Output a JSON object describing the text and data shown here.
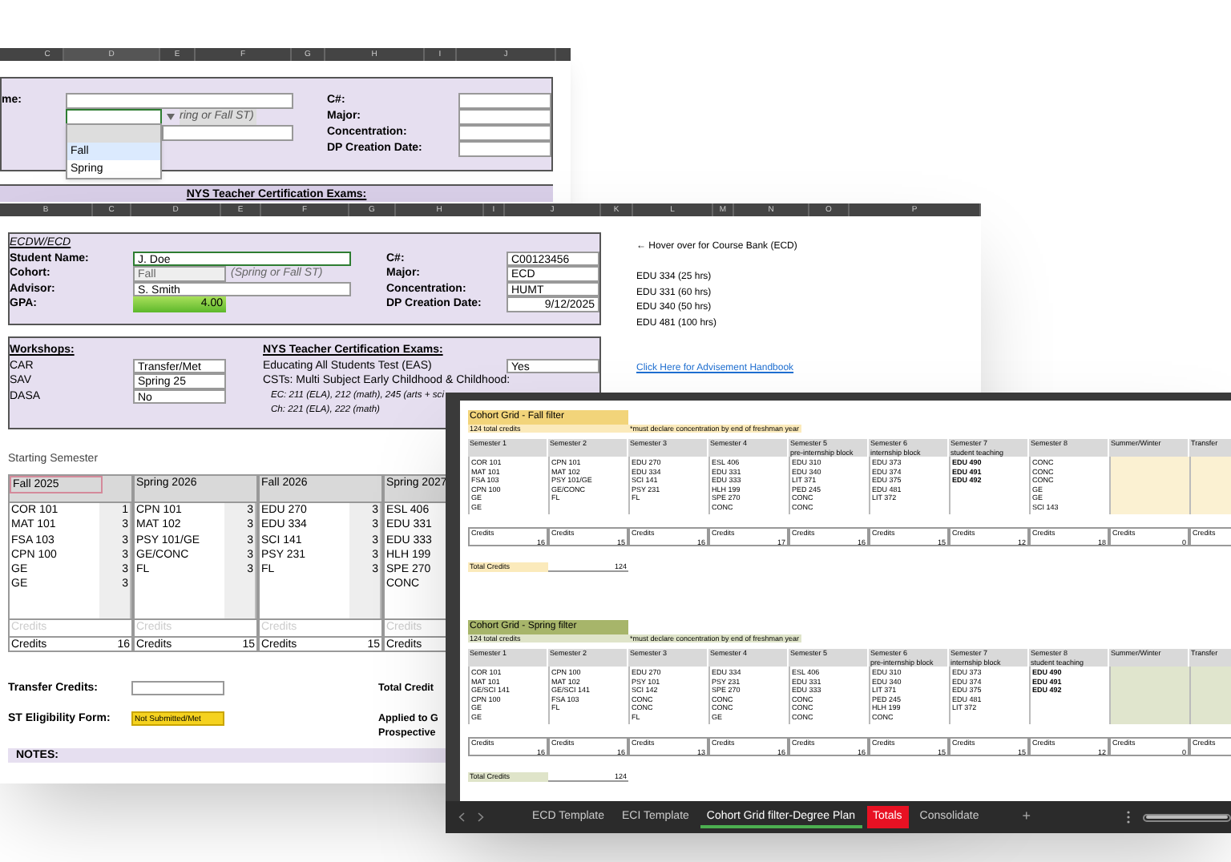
{
  "back_sheet": {
    "columns": [
      "C",
      "D",
      "E",
      "F",
      "G",
      "H",
      "I",
      "J"
    ],
    "student_label": "me:",
    "cohort_hint": "ring or Fall ST)",
    "dropdown_options": [
      {
        "label": "Fall",
        "selected": true
      },
      {
        "label": "Spring",
        "selected": false
      }
    ],
    "labels": [
      "C#:",
      "Major:",
      "Concentration:",
      "DP Creation Date:"
    ],
    "exams_heading": "NYS Teacher Certification Exams:"
  },
  "front_sheet": {
    "columns": [
      "B",
      "C",
      "D",
      "E",
      "F",
      "G",
      "H",
      "I",
      "J",
      "K",
      "L",
      "M",
      "N",
      "O",
      "P"
    ],
    "title": "ECDW/ECD",
    "student_fields": [
      {
        "label": "Student Name:",
        "value": "J. Doe"
      },
      {
        "label": "Cohort:",
        "value": "Fall",
        "hint": "(Spring or Fall ST)"
      },
      {
        "label": "Advisor:",
        "value": "S. Smith"
      },
      {
        "label": "GPA:",
        "value": "4.00"
      }
    ],
    "program_fields": [
      {
        "label": "C#:",
        "value": "C00123456"
      },
      {
        "label": "Major:",
        "value": "ECD"
      },
      {
        "label": "Concentration:",
        "value": "HUMT"
      },
      {
        "label": "DP Creation Date:",
        "value": "9/12/2025"
      }
    ],
    "workshops": {
      "heading": "Workshops:",
      "items": [
        {
          "label": "CAR",
          "value": "Transfer/Met"
        },
        {
          "label": "SAV",
          "value": "Spring 25"
        },
        {
          "label": "DASA",
          "value": "No"
        }
      ]
    },
    "exams": {
      "heading": "NYS Teacher Certification Exams:",
      "eas_label": "Educating All Students Test (EAS)",
      "eas_value": "Yes",
      "cst_label": "CSTs: Multi Subject Early Childhood & Childhood:",
      "cst_lines": [
        "EC: 211 (ELA), 212 (math), 245 (arts + sci",
        "Ch: 221 (ELA), 222 (math)"
      ]
    },
    "side_notes": {
      "hover_note": "← Hover over for Course Bank (ECD)",
      "hours": [
        "EDU 334 (25 hrs)",
        "EDU 331 (60 hrs)",
        "EDU 340 (50 hrs)",
        "EDU 481 (100 hrs)"
      ],
      "link": "Click Here for Advisement Handbook"
    },
    "starting_semester_label": "Starting Semester",
    "semesters": [
      {
        "name": "Fall 2025",
        "selected": true,
        "courses": [
          {
            "code": "COR 101",
            "credits": "1"
          },
          {
            "code": "MAT 101",
            "credits": "3"
          },
          {
            "code": "FSA 103",
            "credits": "3"
          },
          {
            "code": "CPN 100",
            "credits": "3"
          },
          {
            "code": "GE",
            "credits": "3"
          },
          {
            "code": "GE",
            "credits": "3"
          }
        ],
        "faded_label": "Credits",
        "credits_label": "Credits",
        "credits": "16"
      },
      {
        "name": "Spring 2026",
        "selected": false,
        "courses": [
          {
            "code": "CPN 101",
            "credits": "3"
          },
          {
            "code": "MAT 102",
            "credits": "3"
          },
          {
            "code": "PSY 101/GE",
            "credits": "3"
          },
          {
            "code": "GE/CONC",
            "credits": "3"
          },
          {
            "code": "FL",
            "credits": "3"
          }
        ],
        "faded_label": "Credits",
        "credits_label": "Credits",
        "credits": "15"
      },
      {
        "name": "Fall 2026",
        "selected": false,
        "courses": [
          {
            "code": "EDU 270",
            "credits": "3"
          },
          {
            "code": "EDU 334",
            "credits": "3"
          },
          {
            "code": "SCI 141",
            "credits": "3"
          },
          {
            "code": "PSY 231",
            "credits": "3"
          },
          {
            "code": "FL",
            "credits": "3"
          }
        ],
        "faded_label": "Credits",
        "credits_label": "Credits",
        "credits": "15"
      },
      {
        "name": "Spring 2027",
        "selected": false,
        "courses": [
          {
            "code": "ESL 406"
          },
          {
            "code": "EDU 331"
          },
          {
            "code": "EDU 333"
          },
          {
            "code": "HLH 199"
          },
          {
            "code": "SPE 270"
          },
          {
            "code": "CONC"
          }
        ],
        "faded_label": "Credits",
        "credits_label": "Credits"
      }
    ],
    "transfer_label": "Transfer Credits:",
    "st_label": "ST Eligibility Form:",
    "st_value": "Not Submitted/Met",
    "total_label": "Total Credit",
    "applied_lines": [
      "Applied to G",
      "Prospective"
    ],
    "notes_label": "NOTES:"
  },
  "cohort_sheet": {
    "grids": [
      {
        "kind": "fall",
        "title": "Cohort Grid - Fall filter",
        "subtitle": "124 total credits",
        "note": "*must declare concentration by end of freshman year",
        "total_label": "Total Credits",
        "total": "124",
        "columns": [
          {
            "header": "Semester 1",
            "bold": false,
            "tinted": false,
            "courses": [
              "COR 101",
              "MAT 101",
              "FSA 103",
              "CPN 100",
              "GE",
              "GE"
            ],
            "credits_label": "Credits",
            "credits": "16"
          },
          {
            "header": "Semester 2",
            "bold": false,
            "tinted": false,
            "courses": [
              "CPN 101",
              "MAT 102",
              "PSY 101/GE",
              "GE/CONC",
              "FL"
            ],
            "credits_label": "Credits",
            "credits": "15"
          },
          {
            "header": "Semester 3",
            "bold": false,
            "tinted": false,
            "courses": [
              "EDU 270",
              "EDU 334",
              "SCI 141",
              "PSY 231",
              "FL"
            ],
            "credits_label": "Credits",
            "credits": "16"
          },
          {
            "header": "Semester 4",
            "bold": false,
            "tinted": false,
            "courses": [
              "ESL 406",
              "EDU 331",
              "EDU 333",
              "HLH 199",
              "SPE 270",
              "CONC"
            ],
            "credits_label": "Credits",
            "credits": "17"
          },
          {
            "header": "Semester 5",
            "subheader": "pre-internship block",
            "bold": false,
            "tinted": false,
            "courses": [
              "EDU 310",
              "EDU 340",
              "LIT 371",
              "PED 245",
              "CONC",
              "CONC"
            ],
            "credits_label": "Credits",
            "credits": "16"
          },
          {
            "header": "Semester 6",
            "subheader": "internship block",
            "bold": false,
            "tinted": false,
            "courses": [
              "EDU 373",
              "EDU 374",
              "EDU 375",
              "EDU 481",
              "LIT 372"
            ],
            "credits_label": "Credits",
            "credits": "15"
          },
          {
            "header": "Semester 7",
            "subheader": "student teaching",
            "bold": true,
            "tinted": false,
            "courses": [
              "EDU 490",
              "EDU 491",
              "EDU 492"
            ],
            "credits_label": "Credits",
            "credits": "12"
          },
          {
            "header": "Semester 8",
            "bold": false,
            "tinted": false,
            "courses": [
              "CONC",
              "CONC",
              "CONC",
              "GE",
              "GE",
              "SCI 143"
            ],
            "credits_label": "Credits",
            "credits": "18"
          },
          {
            "header": "Summer/Winter",
            "tinted": true,
            "credits_label": "Credits",
            "credits": "0"
          },
          {
            "header": "Transfer",
            "tinted": true,
            "credits_label": "Credits"
          }
        ]
      },
      {
        "kind": "spring",
        "title": "Cohort Grid - Spring filter",
        "subtitle": "124 total credits",
        "note": "*must declare concentration by end of freshman year",
        "total_label": "Total Credits",
        "total": "124",
        "columns": [
          {
            "header": "Semester 1",
            "bold": false,
            "tinted": false,
            "courses": [
              "COR 101",
              "MAT 101",
              "GE/SCI 141",
              "CPN 100",
              "GE",
              "GE"
            ],
            "credits_label": "Credits",
            "credits": "16"
          },
          {
            "header": "Semester 2",
            "bold": false,
            "tinted": false,
            "courses": [
              "CPN 100",
              "MAT 102",
              "GE/SCI 141",
              "FSA 103",
              "FL"
            ],
            "credits_label": "Credits",
            "credits": "16"
          },
          {
            "header": "Semester 3",
            "bold": false,
            "tinted": false,
            "courses": [
              "EDU 270",
              "PSY 101",
              "SCI 142",
              "CONC",
              "CONC",
              "FL"
            ],
            "credits_label": "Credits",
            "credits": "13"
          },
          {
            "header": "Semester 4",
            "bold": false,
            "tinted": false,
            "courses": [
              "EDU 334",
              "PSY 231",
              "SPE 270",
              "CONC",
              "CONC",
              "GE"
            ],
            "credits_label": "Credits",
            "credits": "16"
          },
          {
            "header": "Semester 5",
            "bold": false,
            "tinted": false,
            "courses": [
              "ESL 406",
              "EDU 331",
              "EDU 333",
              "CONC",
              "CONC",
              "CONC"
            ],
            "credits_label": "Credits",
            "credits": "16"
          },
          {
            "header": "Semester 6",
            "subheader": "pre-internship block",
            "bold": false,
            "tinted": false,
            "courses": [
              "EDU 310",
              "EDU 340",
              "LIT 371",
              "PED 245",
              "HLH 199",
              "CONC"
            ],
            "credits_label": "Credits",
            "credits": "15"
          },
          {
            "header": "Semester 7",
            "subheader": "internship block",
            "bold": false,
            "tinted": false,
            "courses": [
              "EDU 373",
              "EDU 374",
              "EDU 375",
              "EDU 481",
              "LIT 372"
            ],
            "credits_label": "Credits",
            "credits": "15"
          },
          {
            "header": "Semester 8",
            "subheader": "student teaching",
            "bold": true,
            "tinted": false,
            "courses": [
              "EDU 490",
              "EDU 491",
              "EDU 492"
            ],
            "credits_label": "Credits",
            "credits": "12"
          },
          {
            "header": "Summer/Winter",
            "tinted": true,
            "credits_label": "Credits",
            "credits": "0"
          },
          {
            "header": "Transfer",
            "tinted": true,
            "credits_label": "Credits"
          }
        ]
      }
    ],
    "tabs": [
      {
        "label": "ECD Template",
        "selected": false
      },
      {
        "label": "ECI Template",
        "selected": false
      },
      {
        "label": "Cohort Grid filter-Degree Plan",
        "selected": true
      },
      {
        "label": "Totals",
        "selected": false,
        "color": "#e81123"
      },
      {
        "label": "Consolidate",
        "selected": false
      }
    ],
    "add_tab": "+"
  }
}
